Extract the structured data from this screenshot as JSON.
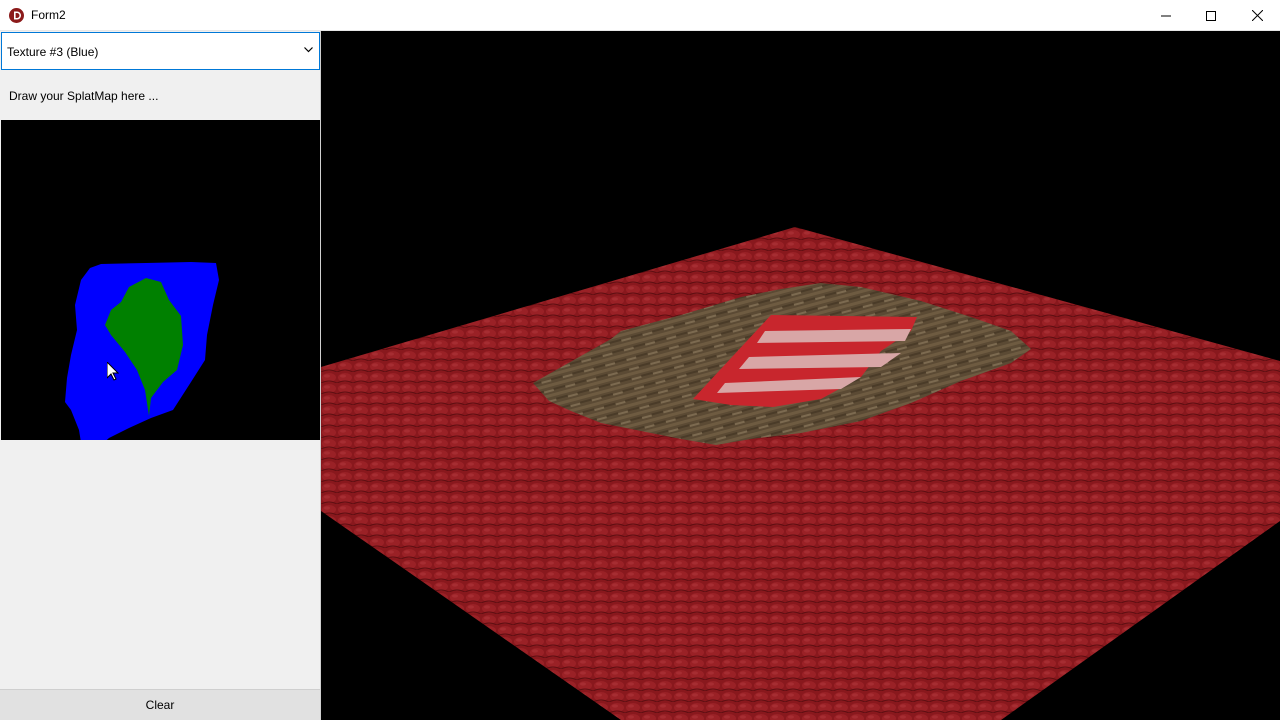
{
  "window": {
    "title": "Form2",
    "minimize_label": "",
    "maximize_label": "",
    "close_label": ""
  },
  "sidebar": {
    "texture_select": {
      "selected": "Texture #3 (Blue)"
    },
    "hint": "Draw your SplatMap here ...",
    "clear_label": "Clear"
  },
  "splatmap": {
    "background": "#000000",
    "colors": {
      "blue": "#0000ff",
      "green": "#008000"
    }
  },
  "viewport": {
    "ground_color": "#9c1c22",
    "wood_color": "#5b4a34",
    "stripe_colors": [
      "#c8262d",
      "#d8a6a6"
    ]
  },
  "colors": {
    "accent": "#0078d7",
    "app_icon": "#8b1a1a"
  }
}
